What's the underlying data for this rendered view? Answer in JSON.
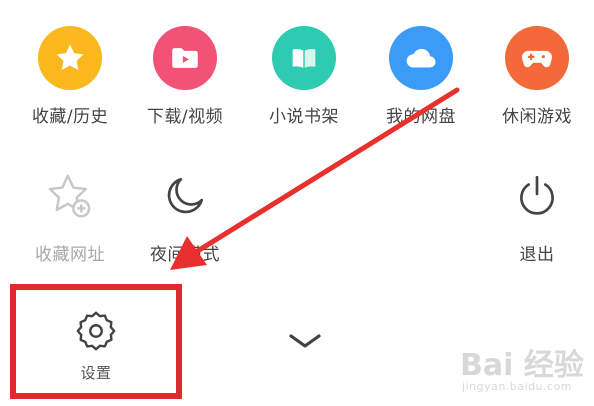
{
  "menu": {
    "row1": [
      {
        "label": "收藏/历史",
        "icon": "star-icon",
        "color": "#fbb81c"
      },
      {
        "label": "下载/视频",
        "icon": "video-folder-icon",
        "color": "#f15275"
      },
      {
        "label": "小说书架",
        "icon": "book-icon",
        "color": "#2dcbb0"
      },
      {
        "label": "我的网盘",
        "icon": "cloud-icon",
        "color": "#3a9cf7"
      },
      {
        "label": "休闲游戏",
        "icon": "gamepad-icon",
        "color": "#f3693a"
      }
    ],
    "row2": [
      {
        "label": "收藏网址",
        "icon": "star-add-icon"
      },
      {
        "label": "夜间模式",
        "icon": "moon-icon"
      },
      {
        "label": "退出",
        "icon": "power-icon"
      }
    ],
    "settings": {
      "label": "设置",
      "icon": "gear-icon"
    },
    "collapse": {
      "icon": "chevron-down-icon"
    }
  },
  "annotation": {
    "highlight_color": "#e0292e"
  },
  "watermark": {
    "brand": "Bai 经验",
    "site": "jingyan.baidu.com"
  }
}
